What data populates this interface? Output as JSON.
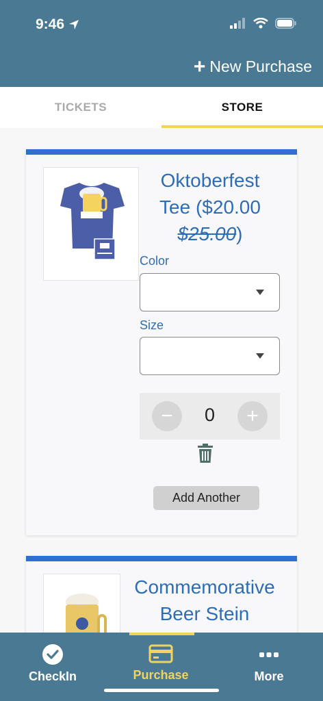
{
  "status_bar": {
    "time": "9:46"
  },
  "header": {
    "new_purchase_label": "New Purchase"
  },
  "tabs": [
    {
      "label": "TICKETS",
      "active": false
    },
    {
      "label": "STORE",
      "active": true
    }
  ],
  "products": [
    {
      "title_line1": "Oktoberfest",
      "title_line2_prefix": "Tee ($20.00",
      "original_price": "$25.00",
      "title_suffix": ")",
      "color_label": "Color",
      "size_label": "Size",
      "quantity": "0",
      "add_another_label": "Add Another"
    },
    {
      "title_line1": "Commemorative",
      "title_line2": "Beer Stein"
    }
  ],
  "bottom_nav": {
    "items": [
      {
        "label": "CheckIn",
        "icon": "check-circle-icon"
      },
      {
        "label": "Purchase",
        "icon": "credit-card-icon",
        "active": true
      },
      {
        "label": "More",
        "icon": "more-dots-icon"
      }
    ]
  },
  "colors": {
    "header_bg": "#4a7a93",
    "accent_yellow": "#f2d45c",
    "title_blue": "#2e6db5",
    "card_bar_blue": "#2f6fd0"
  }
}
